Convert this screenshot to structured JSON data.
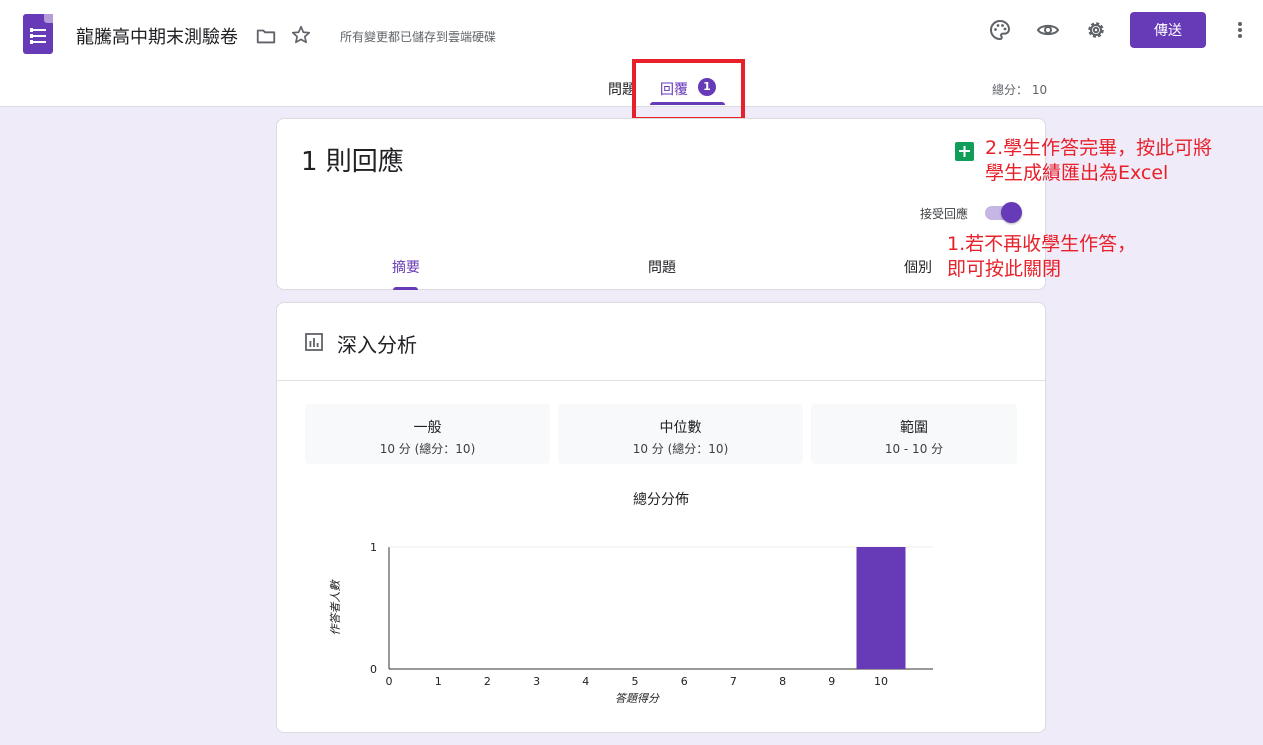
{
  "header": {
    "title": "龍騰高中期末測驗卷",
    "save_status": "所有變更都已儲存到雲端硬碟",
    "send_label": "傳送",
    "accent_color": "#673ab7"
  },
  "tabs": {
    "questions": "問題",
    "responses": "回覆",
    "responses_badge": "1",
    "total_points": "總分： 10"
  },
  "responses_card": {
    "count": "1 則回應",
    "accept_label": "接受回應",
    "accepting": true,
    "subtabs": {
      "summary": "摘要",
      "question": "問題",
      "individual": "個別"
    }
  },
  "insights": {
    "title": "深入分析",
    "stats": [
      {
        "label": "一般",
        "value": "10 分 (總分：10)"
      },
      {
        "label": "中位數",
        "value": "10 分 (總分：10)"
      },
      {
        "label": "範圍",
        "value": "10 - 10 分"
      }
    ]
  },
  "chart_data": {
    "type": "bar",
    "title": "總分分佈",
    "xlabel": "答題得分",
    "ylabel": "作答者人數",
    "categories": [
      "0",
      "1",
      "2",
      "3",
      "4",
      "5",
      "6",
      "7",
      "8",
      "9",
      "10"
    ],
    "values": [
      0,
      0,
      0,
      0,
      0,
      0,
      0,
      0,
      0,
      0,
      1
    ],
    "yticks": [
      "0",
      "1"
    ],
    "ylim": [
      0,
      1
    ],
    "bar_color": "#673ab7",
    "grid": false
  },
  "annotations": {
    "note1_line1": "1.若不再收學生作答，",
    "note1_line2": "即可按此關閉",
    "note2_line1": "2.學生作答完畢，按此可將",
    "note2_line2": "學生成績匯出為Excel"
  }
}
